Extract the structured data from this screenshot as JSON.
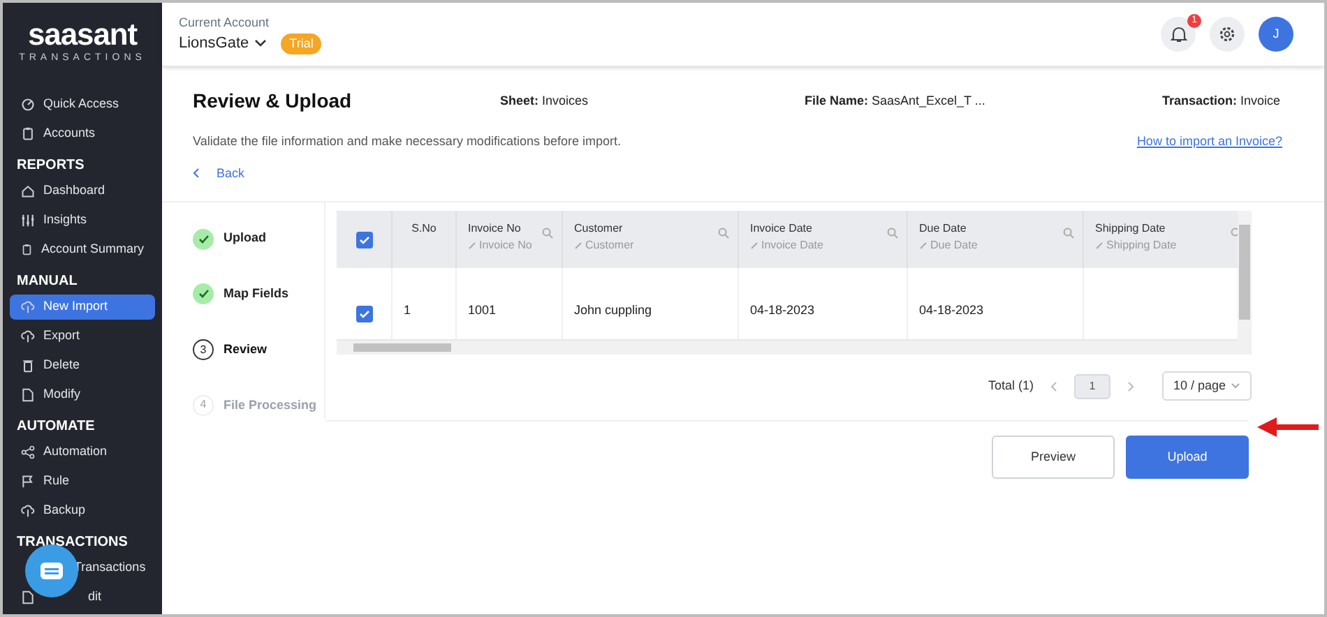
{
  "logo": {
    "name": "saasant",
    "tagline": "TRANSACTIONS"
  },
  "sidebar": {
    "sections": [
      {
        "items": [
          {
            "label": "Quick Access",
            "selected": false
          },
          {
            "label": "Accounts",
            "selected": false
          }
        ]
      },
      {
        "heading": "REPORTS",
        "items": [
          {
            "label": "Dashboard",
            "selected": false
          },
          {
            "label": "Insights",
            "selected": false
          },
          {
            "label": "Account Summary",
            "selected": false
          }
        ]
      },
      {
        "heading": "MANUAL",
        "items": [
          {
            "label": "New Import",
            "selected": true
          },
          {
            "label": "Export",
            "selected": false
          },
          {
            "label": "Delete",
            "selected": false
          },
          {
            "label": "Modify",
            "selected": false
          }
        ]
      },
      {
        "heading": "AUTOMATE",
        "items": [
          {
            "label": "Automation",
            "selected": false
          },
          {
            "label": "Rule",
            "selected": false
          },
          {
            "label": "Backup",
            "selected": false
          }
        ]
      },
      {
        "heading": "TRANSACTIONS",
        "items": [
          {
            "label": "Transactions",
            "selected": false
          },
          {
            "label": "dit",
            "selected": false
          }
        ]
      }
    ]
  },
  "header": {
    "account_label": "Current Account",
    "account": "LionsGate",
    "badge": "Trial",
    "notifications": "1",
    "avatar": "J"
  },
  "page": {
    "title": "Review & Upload",
    "sheet_label": "Sheet:",
    "sheet": "Invoices",
    "file_label": "File Name:",
    "file": "SaasAnt_Excel_T ...",
    "transaction_label": "Transaction:",
    "transaction": "Invoice",
    "description": "Validate the file information and make necessary modifications before import.",
    "help_link": "How to import an Invoice?",
    "back": "Back"
  },
  "steps": [
    {
      "label": "Upload",
      "completed": true,
      "selected": false
    },
    {
      "label": "Map Fields",
      "completed": true,
      "selected": false
    },
    {
      "label": "Review",
      "number": "3",
      "completed": false,
      "selected": true
    },
    {
      "label": "File Processing",
      "number": "4",
      "completed": false,
      "selected": false
    }
  ],
  "table": {
    "all_checked": true,
    "columns": [
      {
        "title": "S.No"
      },
      {
        "title": "Invoice No",
        "mapped": "Invoice No"
      },
      {
        "title": "Customer",
        "mapped": "Customer"
      },
      {
        "title": "Invoice Date",
        "mapped": "Invoice Date"
      },
      {
        "title": "Due Date",
        "mapped": "Due Date"
      },
      {
        "title": "Shipping Date",
        "mapped": "Shipping Date"
      }
    ],
    "rows": [
      {
        "checked": true,
        "cells": [
          "1",
          "1001",
          "John cuppling",
          "04-18-2023",
          "04-18-2023",
          ""
        ]
      }
    ]
  },
  "pagination": {
    "total": "Total (1)",
    "pages": [
      {
        "label": "1",
        "selected": true
      }
    ],
    "page_size": "10 / page"
  },
  "buttons": [
    {
      "label": "Preview",
      "kind": "secondary"
    },
    {
      "label": "Upload",
      "kind": "primary"
    }
  ]
}
